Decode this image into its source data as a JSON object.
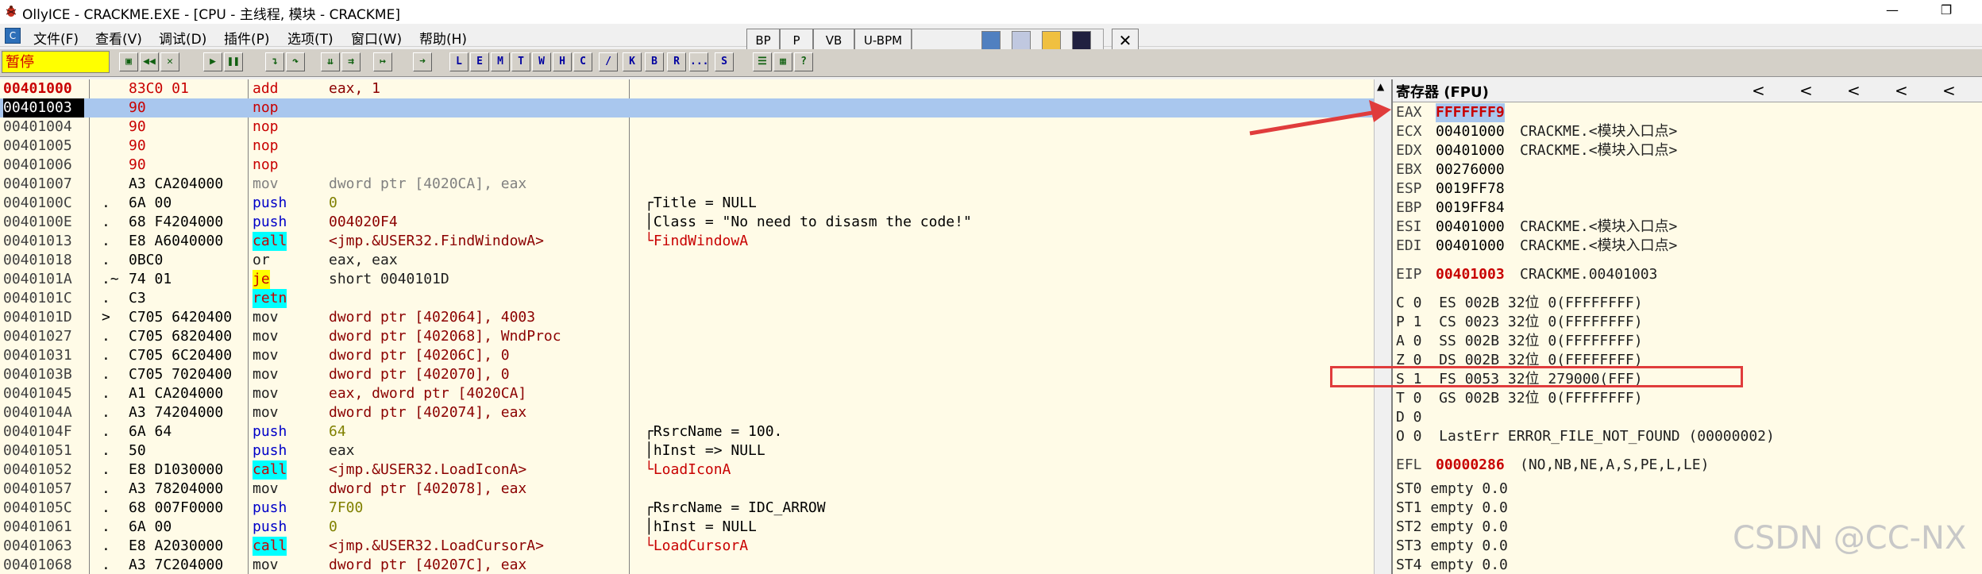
{
  "window": {
    "title": "OllyICE - CRACKME.EXE - [CPU - 主线程, 模块 - CRACKME]",
    "minimize": "—",
    "restore": "❐"
  },
  "menu": [
    "文件(F)",
    "查看(V)",
    "调试(D)",
    "插件(P)",
    "选项(T)",
    "窗口(W)",
    "帮助(H)"
  ],
  "viewbuttons": [
    "BP",
    "P",
    "VB",
    "U-BPM"
  ],
  "toolbar": {
    "status": "暂停",
    "letters": [
      "L",
      "E",
      "M",
      "T",
      "W",
      "H",
      "C",
      "/",
      "K",
      "B",
      "R",
      "...",
      "S"
    ]
  },
  "disasm": [
    {
      "addr": "00401000",
      "mark": "",
      "hex": "83C0 01",
      "mn": "add",
      "arg": "eax, 1",
      "cm": "",
      "addr_style": "cur",
      "hex_style": "red",
      "mn_style": "m-red",
      "arg_style": "a-darkred",
      "cm_style": ""
    },
    {
      "addr": "00401003",
      "mark": "",
      "hex": "90",
      "mn": "nop",
      "arg": "",
      "cm": "",
      "addr_style": "",
      "hex_style": "red",
      "mn_style": "m-red",
      "arg_style": "",
      "cm_style": "",
      "sel": true
    },
    {
      "addr": "00401004",
      "mark": "",
      "hex": "90",
      "mn": "nop",
      "arg": "",
      "cm": "",
      "addr_style": "",
      "hex_style": "red",
      "mn_style": "m-red",
      "arg_style": "",
      "cm_style": ""
    },
    {
      "addr": "00401005",
      "mark": "",
      "hex": "90",
      "mn": "nop",
      "arg": "",
      "cm": "",
      "addr_style": "",
      "hex_style": "red",
      "mn_style": "m-red",
      "arg_style": "",
      "cm_style": ""
    },
    {
      "addr": "00401006",
      "mark": "",
      "hex": "90",
      "mn": "nop",
      "arg": "",
      "cm": "",
      "addr_style": "",
      "hex_style": "red",
      "mn_style": "m-red",
      "arg_style": "",
      "cm_style": ""
    },
    {
      "addr": "00401007",
      "mark": "",
      "hex": "A3 CA204000",
      "mn": "mov",
      "arg": "dword ptr [4020CA], eax",
      "cm": "",
      "addr_style": "",
      "hex_style": "",
      "mn_style": "m-gray",
      "arg_style": "a-gray",
      "cm_style": ""
    },
    {
      "addr": "0040100C",
      "mark": ".",
      "hex": "6A 00",
      "mn": "push",
      "arg": "0",
      "cm": "┌Title = NULL",
      "addr_style": "",
      "hex_style": "",
      "mn_style": "m-blue",
      "arg_style": "a-olive",
      "cm_style": "c-black"
    },
    {
      "addr": "0040100E",
      "mark": ".",
      "hex": "68 F4204000",
      "mn": "push",
      "arg": "004020F4",
      "cm": "│Class = \"No need to disasm the code!\"",
      "addr_style": "",
      "hex_style": "",
      "mn_style": "m-blue",
      "arg_style": "a-darkred",
      "cm_style": "c-black"
    },
    {
      "addr": "00401013",
      "mark": ".",
      "hex": "E8 A6040000",
      "mn": "call",
      "arg": "<jmp.&USER32.FindWindowA>",
      "cm": "└FindWindowA",
      "addr_style": "",
      "hex_style": "",
      "mn_style": "m-cyan",
      "arg_style": "a-darkred",
      "cm_style": "c-red"
    },
    {
      "addr": "00401018",
      "mark": ".",
      "hex": "0BC0",
      "mn": "or",
      "arg": "eax, eax",
      "cm": "",
      "addr_style": "",
      "hex_style": "",
      "mn_style": "m-dark",
      "arg_style": "a-black",
      "cm_style": ""
    },
    {
      "addr": "0040101A",
      "mark": ".~",
      "hex": "74 01",
      "mn": "je",
      "arg": "short 0040101D",
      "cm": "",
      "addr_style": "",
      "hex_style": "",
      "mn_style": "m-jcc",
      "arg_style": "a-black",
      "cm_style": ""
    },
    {
      "addr": "0040101C",
      "mark": ".",
      "hex": "C3",
      "mn": "retn",
      "arg": "",
      "cm": "",
      "addr_style": "",
      "hex_style": "",
      "mn_style": "m-cyan",
      "arg_style": "",
      "cm_style": ""
    },
    {
      "addr": "0040101D",
      "mark": ">",
      "hex": "C705 6420400",
      "mn": "mov",
      "arg": "dword ptr [402064], 4003",
      "cm": "",
      "addr_style": "",
      "hex_style": "",
      "mn_style": "m-dark",
      "arg_style": "a-darkred",
      "cm_style": ""
    },
    {
      "addr": "00401027",
      "mark": ".",
      "hex": "C705 6820400",
      "mn": "mov",
      "arg": "dword ptr [402068], WndProc",
      "cm": "",
      "addr_style": "",
      "hex_style": "",
      "mn_style": "m-dark",
      "arg_style": "a-darkred",
      "cm_style": ""
    },
    {
      "addr": "00401031",
      "mark": ".",
      "hex": "C705 6C20400",
      "mn": "mov",
      "arg": "dword ptr [40206C], 0",
      "cm": "",
      "addr_style": "",
      "hex_style": "",
      "mn_style": "m-dark",
      "arg_style": "a-darkred",
      "cm_style": ""
    },
    {
      "addr": "0040103B",
      "mark": ".",
      "hex": "C705 7020400",
      "mn": "mov",
      "arg": "dword ptr [402070], 0",
      "cm": "",
      "addr_style": "",
      "hex_style": "",
      "mn_style": "m-dark",
      "arg_style": "a-darkred",
      "cm_style": ""
    },
    {
      "addr": "00401045",
      "mark": ".",
      "hex": "A1 CA204000",
      "mn": "mov",
      "arg": "eax, dword ptr [4020CA]",
      "cm": "",
      "addr_style": "",
      "hex_style": "",
      "mn_style": "m-dark",
      "arg_style": "a-darkred",
      "cm_style": ""
    },
    {
      "addr": "0040104A",
      "mark": ".",
      "hex": "A3 74204000",
      "mn": "mov",
      "arg": "dword ptr [402074], eax",
      "cm": "",
      "addr_style": "",
      "hex_style": "",
      "mn_style": "m-dark",
      "arg_style": "a-darkred",
      "cm_style": ""
    },
    {
      "addr": "0040104F",
      "mark": ".",
      "hex": "6A 64",
      "mn": "push",
      "arg": "64",
      "cm": "┌RsrcName = 100.",
      "addr_style": "",
      "hex_style": "",
      "mn_style": "m-blue",
      "arg_style": "a-olive",
      "cm_style": "c-black"
    },
    {
      "addr": "00401051",
      "mark": ".",
      "hex": "50",
      "mn": "push",
      "arg": "eax",
      "cm": "│hInst => NULL",
      "addr_style": "",
      "hex_style": "",
      "mn_style": "m-blue",
      "arg_style": "a-black",
      "cm_style": "c-black"
    },
    {
      "addr": "00401052",
      "mark": ".",
      "hex": "E8 D1030000",
      "mn": "call",
      "arg": "<jmp.&USER32.LoadIconA>",
      "cm": "└LoadIconA",
      "addr_style": "",
      "hex_style": "",
      "mn_style": "m-cyan",
      "arg_style": "a-darkred",
      "cm_style": "c-red"
    },
    {
      "addr": "00401057",
      "mark": ".",
      "hex": "A3 78204000",
      "mn": "mov",
      "arg": "dword ptr [402078], eax",
      "cm": "",
      "addr_style": "",
      "hex_style": "",
      "mn_style": "m-dark",
      "arg_style": "a-darkred",
      "cm_style": ""
    },
    {
      "addr": "0040105C",
      "mark": ".",
      "hex": "68 007F0000",
      "mn": "push",
      "arg": "7F00",
      "cm": "┌RsrcName = IDC_ARROW",
      "addr_style": "",
      "hex_style": "",
      "mn_style": "m-blue",
      "arg_style": "a-olive",
      "cm_style": "c-black"
    },
    {
      "addr": "00401061",
      "mark": ".",
      "hex": "6A 00",
      "mn": "push",
      "arg": "0",
      "cm": "│hInst = NULL",
      "addr_style": "",
      "hex_style": "",
      "mn_style": "m-blue",
      "arg_style": "a-olive",
      "cm_style": "c-black"
    },
    {
      "addr": "00401063",
      "mark": ".",
      "hex": "E8 A2030000",
      "mn": "call",
      "arg": "<jmp.&USER32.LoadCursorA>",
      "cm": "└LoadCursorA",
      "addr_style": "",
      "hex_style": "",
      "mn_style": "m-cyan",
      "arg_style": "a-darkred",
      "cm_style": "c-red"
    },
    {
      "addr": "00401068",
      "mark": ".",
      "hex": "A3 7C204000",
      "mn": "mov",
      "arg": "dword ptr [40207C], eax",
      "cm": "",
      "addr_style": "",
      "hex_style": "",
      "mn_style": "m-dark",
      "arg_style": "a-darkred",
      "cm_style": ""
    }
  ],
  "registers": {
    "header": "寄存器 (FPU)",
    "chevrons": [
      "<",
      "<",
      "<",
      "<",
      "<"
    ],
    "rows": [
      {
        "name": "EAX",
        "val": "FFFFFFF9",
        "desc": "",
        "style": "hl"
      },
      {
        "name": "ECX",
        "val": "00401000",
        "desc": "CRACKME.<模块入口点>",
        "style": ""
      },
      {
        "name": "EDX",
        "val": "00401000",
        "desc": "CRACKME.<模块入口点>",
        "style": ""
      },
      {
        "name": "EBX",
        "val": "00276000",
        "desc": "",
        "style": ""
      },
      {
        "name": "ESP",
        "val": "0019FF78",
        "desc": "",
        "style": ""
      },
      {
        "name": "EBP",
        "val": "0019FF84",
        "desc": "",
        "style": ""
      },
      {
        "name": "ESI",
        "val": "00401000",
        "desc": "CRACKME.<模块入口点>",
        "style": ""
      },
      {
        "name": "EDI",
        "val": "00401000",
        "desc": "CRACKME.<模块入口点>",
        "style": ""
      }
    ],
    "eip": {
      "name": "EIP",
      "val": "00401003",
      "desc": "CRACKME.00401003"
    },
    "flags": [
      "C 0  ES 002B 32位 0(FFFFFFFF)",
      "P 1  CS 0023 32位 0(FFFFFFFF)",
      "A 0  SS 002B 32位 0(FFFFFFFF)",
      "Z 0  DS 002B 32位 0(FFFFFFFF)",
      "S 1  FS 0053 32位 279000(FFF)",
      "T 0  GS 002B 32位 0(FFFFFFFF)",
      "D 0",
      "O 0  LastErr ERROR_FILE_NOT_FOUND (00000002)"
    ],
    "efl": {
      "name": "EFL",
      "val": "00000286",
      "desc": "(NO,NB,NE,A,S,PE,L,LE)"
    },
    "fpu": [
      "ST0 empty 0.0",
      "ST1 empty 0.0",
      "ST2 empty 0.0",
      "ST3 empty 0.0",
      "ST4 empty 0.0"
    ]
  },
  "watermark": "CSDN @CC-NX",
  "colors": {
    "annotation": "#e03c3c",
    "selection": "#a9c7ee"
  }
}
